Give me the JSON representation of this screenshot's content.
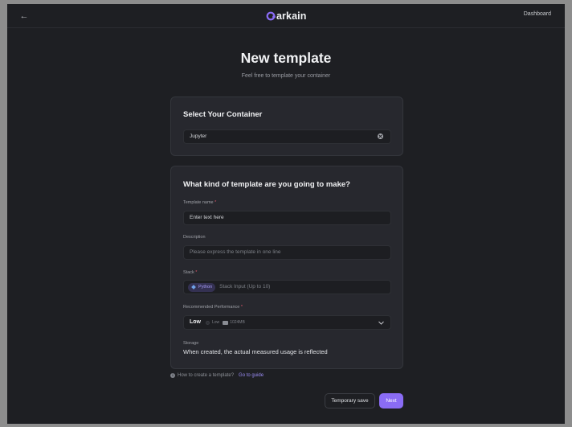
{
  "header": {
    "back_icon": "arrow-left-icon",
    "logo_text": "arkain",
    "logo_color": "#8b6cf6",
    "dashboard_label": "Dashboard"
  },
  "page": {
    "title": "New template",
    "subtitle": "Feel free to template your container"
  },
  "container_card": {
    "heading": "Select Your Container",
    "selected_value": "Jupyter"
  },
  "template_card": {
    "heading": "What kind of template are you going to make?",
    "name_label": "Template name",
    "required_mark": "*",
    "name_value": "Enter text here",
    "description_label": "Description",
    "description_placeholder": "Please express the template in one line",
    "stack_label": "Stack",
    "stack_chip": "Python",
    "stack_placeholder": "Stack Input (Up to 10)",
    "performance_label": "Recommended Performance",
    "performance_level": "Low",
    "performance_tier": "Low",
    "performance_memory": "1024MB",
    "storage_label": "Storage",
    "storage_value": "When created, the actual measured usage is reflected"
  },
  "guide": {
    "question": "How to create a template?",
    "link": "Go to guide"
  },
  "actions": {
    "temp_save": "Temporary save",
    "next": "Next"
  },
  "colors": {
    "accent": "#8a6cf5",
    "background": "#1e1f23",
    "card": "#27282e",
    "required": "#e0566a"
  }
}
